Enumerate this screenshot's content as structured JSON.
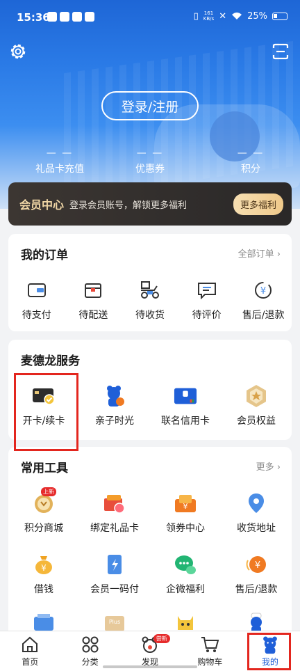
{
  "status_bar": {
    "time": "15:36",
    "speed_top": "161",
    "speed_bottom": "KB/s",
    "battery": "25%"
  },
  "header": {
    "login_label": "登录/注册",
    "stats": [
      {
        "value": "— —",
        "label": "礼品卡充值"
      },
      {
        "value": "— —",
        "label": "优惠券"
      },
      {
        "value": "— —",
        "label": "积分"
      }
    ]
  },
  "member": {
    "title": "会员中心",
    "desc": "登录会员账号，解锁更多福利",
    "more": "更多福利"
  },
  "orders": {
    "title": "我的订单",
    "link": "全部订单 ›",
    "items": [
      {
        "label": "待支付",
        "icon": "wallet-icon"
      },
      {
        "label": "待配送",
        "icon": "package-icon"
      },
      {
        "label": "待收货",
        "icon": "scooter-icon"
      },
      {
        "label": "待评价",
        "icon": "comment-icon"
      },
      {
        "label": "售后/退款",
        "icon": "refund-icon"
      }
    ]
  },
  "services": {
    "title": "麦德龙服务",
    "items": [
      {
        "label": "开卡/续卡",
        "icon": "member-card-icon"
      },
      {
        "label": "亲子时光",
        "icon": "bear-kid-icon"
      },
      {
        "label": "联名信用卡",
        "icon": "credit-card-icon"
      },
      {
        "label": "会员权益",
        "icon": "medal-icon"
      }
    ]
  },
  "tools": {
    "title": "常用工具",
    "link": "更多 ›",
    "row1": [
      {
        "label": "积分商城",
        "icon": "points-mall-icon",
        "badge": "上新"
      },
      {
        "label": "绑定礼品卡",
        "icon": "gift-card-icon"
      },
      {
        "label": "领券中心",
        "icon": "coupon-icon"
      },
      {
        "label": "收货地址",
        "icon": "location-icon"
      }
    ],
    "row2": [
      {
        "label": "借钱",
        "icon": "money-bag-icon"
      },
      {
        "label": "会员一码付",
        "icon": "qr-pay-icon"
      },
      {
        "label": "企微福利",
        "icon": "wechat-work-icon"
      },
      {
        "label": "售后/退款",
        "icon": "refund-icon"
      }
    ]
  },
  "tabbar": {
    "new_badge": "尝新",
    "items": [
      {
        "label": "首页",
        "icon": "home-icon"
      },
      {
        "label": "分类",
        "icon": "category-icon"
      },
      {
        "label": "发现",
        "icon": "discover-icon"
      },
      {
        "label": "购物车",
        "icon": "cart-icon"
      },
      {
        "label": "我的",
        "icon": "bear-profile-icon"
      }
    ]
  },
  "colors": {
    "accent_blue": "#1f5fd8",
    "highlight_red": "#e3261e",
    "member_gold": "#f1d7a6"
  }
}
